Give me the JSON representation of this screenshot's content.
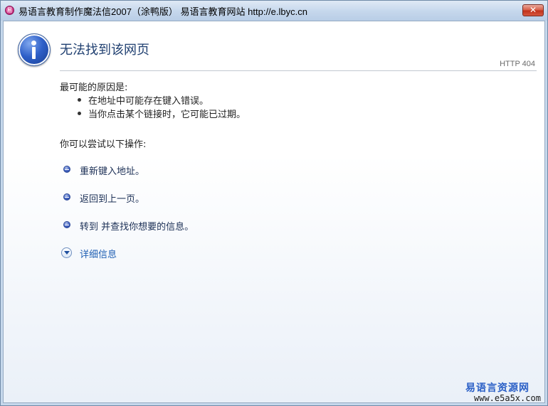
{
  "window": {
    "title": "易语言教育制作魔法信2007（涂鸭版）  易语言教育网站 http://e.lbyc.cn",
    "close_label": "✕",
    "app_icon_glyph": "易"
  },
  "error_page": {
    "title": "无法找到该网页",
    "http_code": "HTTP 404",
    "causes_heading": "最可能的原因是:",
    "causes": [
      "在地址中可能存在键入错误。",
      "当你点击某个链接时，它可能已过期。"
    ],
    "actions_heading": "你可以尝试以下操作:",
    "actions": [
      "重新键入地址。",
      "返回到上一页。",
      "转到  并查找你想要的信息。"
    ],
    "details_link": "详细信息"
  },
  "watermark": {
    "name": "易语言资源网",
    "url": "www.e5a5x.com"
  },
  "colors": {
    "title_text": "#1f3f70",
    "link": "#1f5fb3",
    "close_button": "#c1321c",
    "watermark": "#2a5fc6"
  }
}
